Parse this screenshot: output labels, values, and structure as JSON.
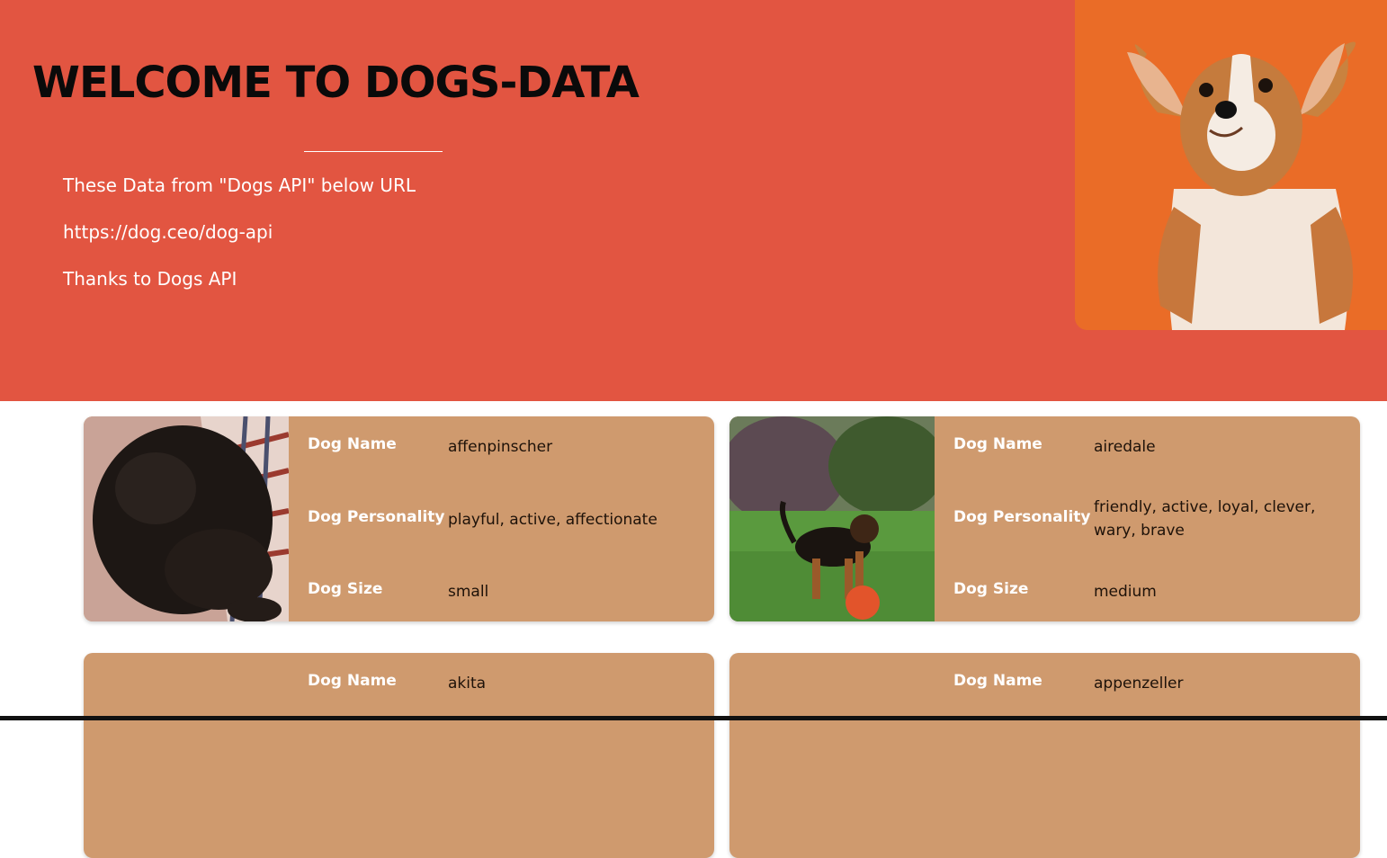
{
  "header": {
    "title": "WELCOME TO DOGS-DATA",
    "line1": "These Data from \"Dogs API\" below URL",
    "line2": "https://dog.ceo/dog-api",
    "line3": "Thanks to Dogs API"
  },
  "labels": {
    "name": "Dog Name",
    "personality": "Dog Personality",
    "size": "Dog Size"
  },
  "dogs": [
    {
      "name": "affenpinscher",
      "personality": "playful, active, affectionate",
      "size": "small"
    },
    {
      "name": "airedale",
      "personality": "friendly, active, loyal, clever, wary, brave",
      "size": "medium"
    },
    {
      "name": "akita"
    },
    {
      "name": "appenzeller"
    }
  ],
  "colors": {
    "hero_bg": "#e25541",
    "card_bg": "#cf9a6e",
    "hero_photo_bg": "#ea6c27"
  }
}
